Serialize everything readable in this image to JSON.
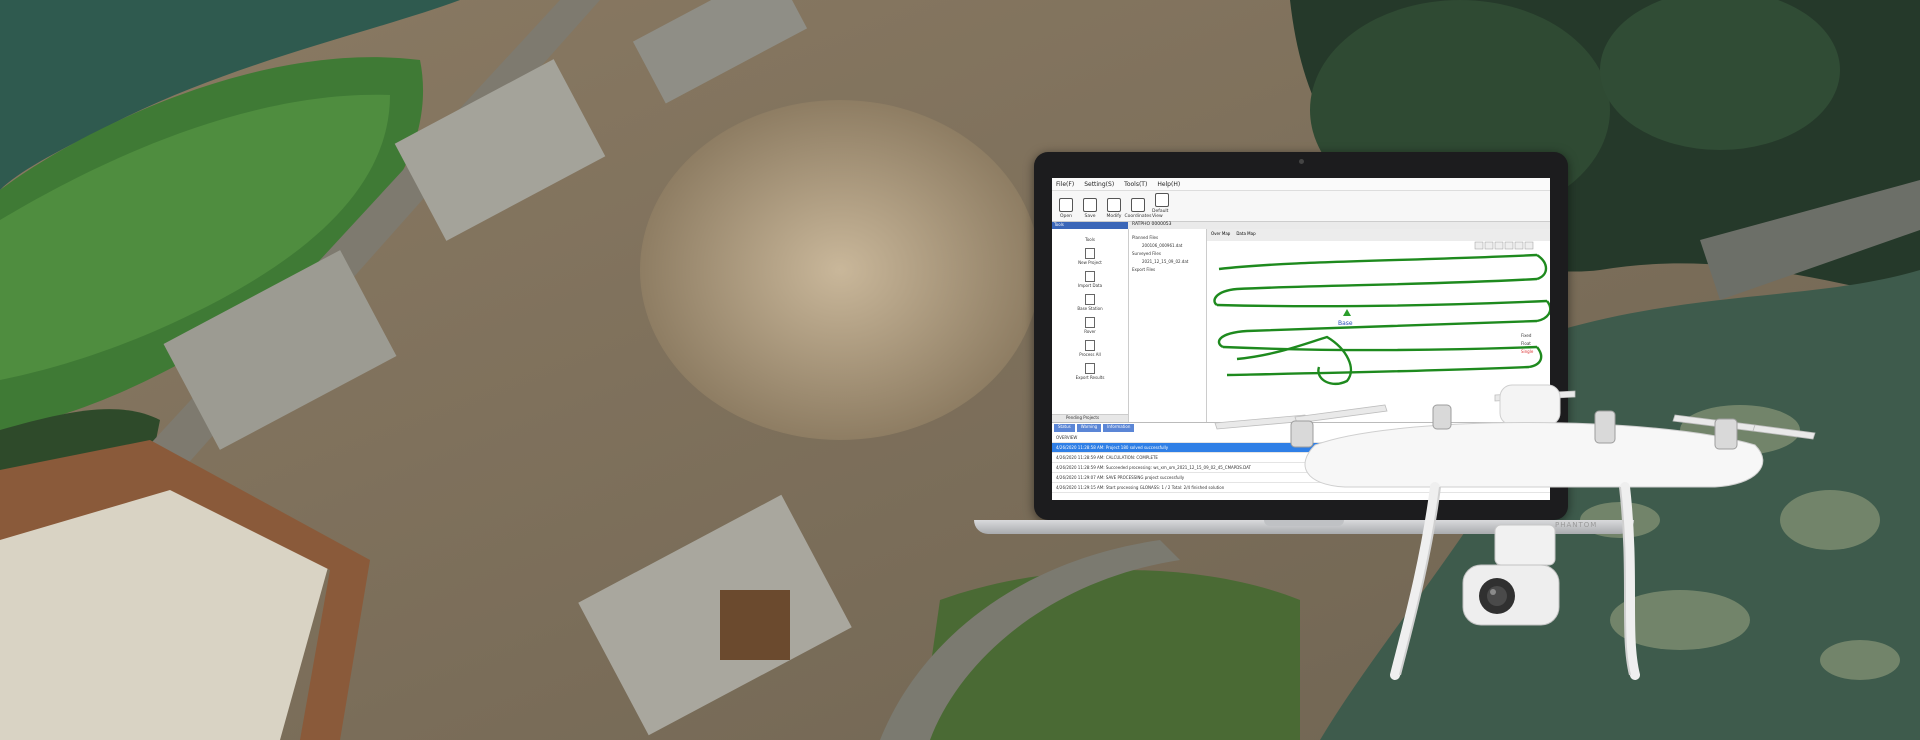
{
  "app": {
    "menu": [
      "File(F)",
      "Setting(S)",
      "Tools(T)",
      "Help(H)"
    ],
    "toolbar": [
      "Open",
      "Save",
      "Modify",
      "Coordinates",
      "Default View"
    ],
    "left_panel": {
      "title": "Tools",
      "tools": [
        "Tools",
        "New Project",
        "Import Data",
        "Base Station",
        "Rover",
        "Process All",
        "Export Results"
      ],
      "footer": "Pending Projects"
    },
    "tree": {
      "header": "RATPHO 0000053",
      "items": [
        "Planned Files",
        "200106_000961.dat",
        "Surveyed Files",
        "2021_12_15_09_02.dat",
        "Export Files"
      ]
    },
    "plot_tabs": [
      "Over Map",
      "Data Map"
    ],
    "base_label": "Base",
    "legend": [
      "Fixed",
      "Float",
      "Single"
    ],
    "log_tabs": [
      "Status",
      "Warning",
      "Information"
    ],
    "log_rows": [
      "OVERVIEW",
      "4/26/2020 11:28:58 AM: Project 180 solved successfully",
      "4/26/2020 11:28:59 AM: CALCULATION: COMPLETE",
      "4/26/2020 11:28:59 AM: Succeeded processing: ws_xm_om_2021_12_15_09_02_45_CMAPDS.DAT",
      "4/26/2020 11:29:07 AM: SAVE PROCESSING project successfully",
      "4/26/2020 11:29:15 AM: Start processing GLONASS: 1 / 2 Total: 2/4 finished solution"
    ]
  },
  "drone_label": "PHANTOM",
  "colors": {
    "track": "#1e8a1e",
    "selection": "#2f7fe6",
    "base": "#2a9d2a"
  }
}
